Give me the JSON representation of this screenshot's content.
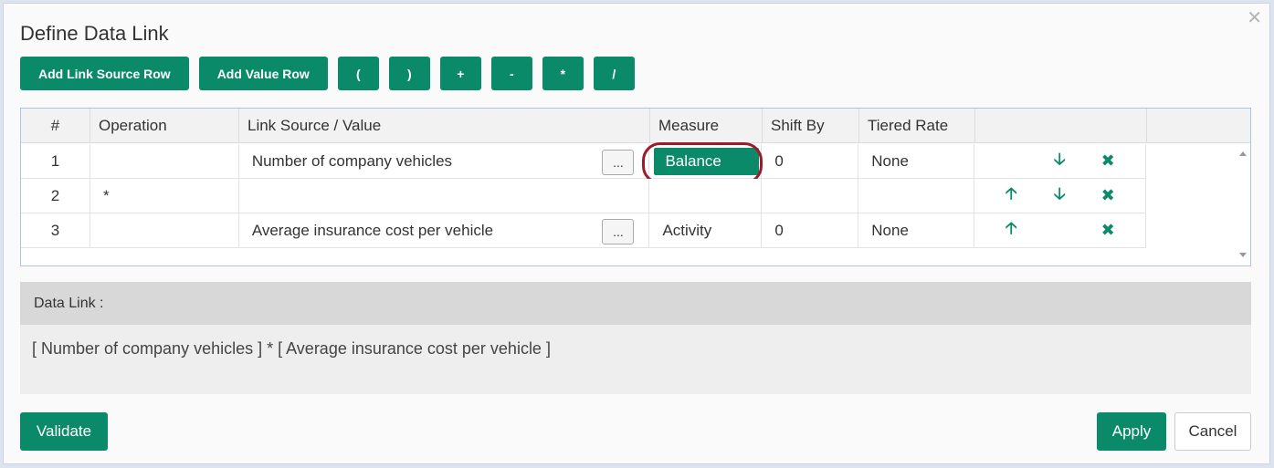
{
  "dialog": {
    "title": "Define Data Link",
    "close_icon": "close-icon"
  },
  "toolbar": {
    "buttons": [
      "Add Link Source Row",
      "Add Value Row"
    ],
    "operators": [
      "(",
      ")",
      "+",
      "-",
      "*",
      "/"
    ]
  },
  "grid": {
    "headers": [
      "#",
      "Operation",
      "Link Source / Value",
      "Measure",
      "Shift By",
      "Tiered Rate",
      ""
    ],
    "ellipsis_label": "...",
    "rows": [
      {
        "num": "1",
        "operation": "",
        "source": "Number of company vehicles",
        "measure": "Balance",
        "shift": "0",
        "tiered": "None"
      },
      {
        "num": "2",
        "operation": "*",
        "source": "",
        "measure": "",
        "shift": "",
        "tiered": ""
      },
      {
        "num": "3",
        "operation": "",
        "source": "Average insurance cost per vehicle",
        "measure": "Activity",
        "shift": "0",
        "tiered": "None"
      }
    ]
  },
  "data_link": {
    "label": "Data Link :",
    "expression": "[ Number of company vehicles ] * [ Average insurance cost per vehicle ]"
  },
  "footer": {
    "validate_label": "Validate",
    "apply_label": "Apply",
    "cancel_label": "Cancel"
  },
  "colors": {
    "accent": "#0b8a6a",
    "highlight": "#9b1b2a"
  }
}
